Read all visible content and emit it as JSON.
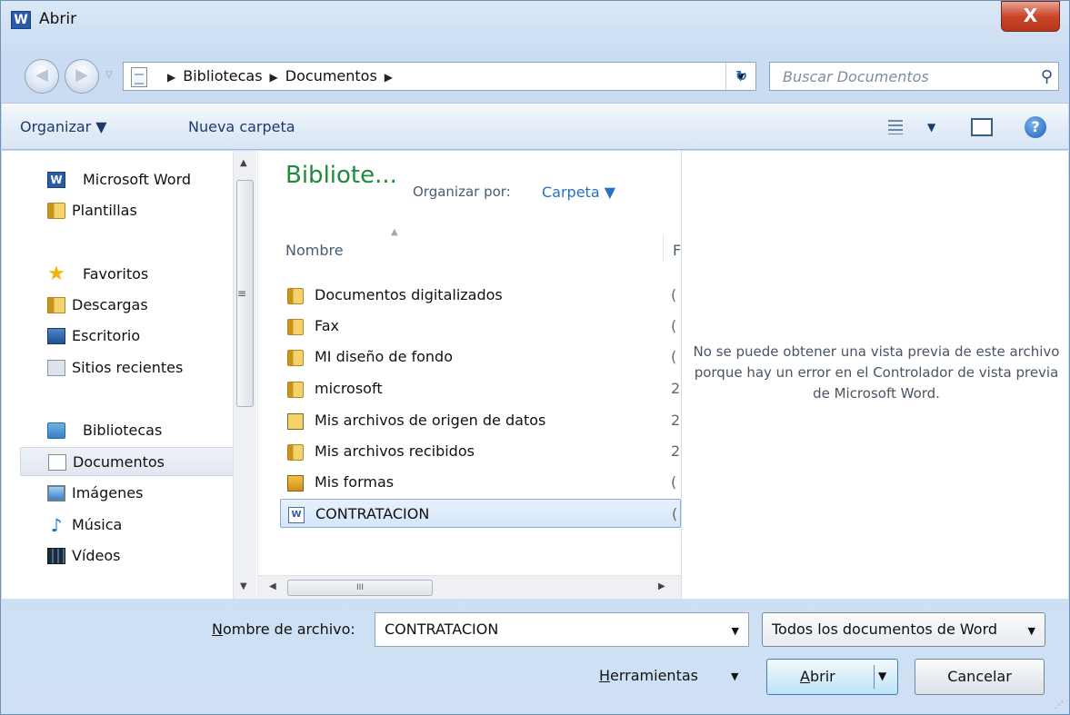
{
  "window": {
    "title": "Abrir",
    "close_label": "X"
  },
  "address_bar": {
    "crumbs": [
      "Bibliotecas",
      "Documentos"
    ],
    "search_placeholder": "Buscar Documentos"
  },
  "toolbar": {
    "organize": "Organizar ▼",
    "new_folder": "Nueva carpeta",
    "help": "?"
  },
  "nav_pane": {
    "groups": [
      {
        "label": "Microsoft Word",
        "items": [
          {
            "label": "Plantillas"
          }
        ]
      },
      {
        "label": "Favoritos",
        "items": [
          {
            "label": "Descargas"
          },
          {
            "label": "Escritorio"
          },
          {
            "label": "Sitios recientes"
          }
        ]
      },
      {
        "label": "Bibliotecas",
        "items": [
          {
            "label": "Documentos"
          },
          {
            "label": "Imágenes"
          },
          {
            "label": "Música"
          },
          {
            "label": "Vídeos"
          }
        ]
      }
    ],
    "selected": "Documentos"
  },
  "file_pane": {
    "library_title": "Bibliote...",
    "arrange_label": "Organizar por:",
    "arrange_value": "Carpeta ▼",
    "column_name": "Nombre",
    "column_next": "F",
    "files": [
      {
        "name": "Documentos digitalizados",
        "trail": "("
      },
      {
        "name": "Fax",
        "trail": "("
      },
      {
        "name": "MI diseño de fondo",
        "trail": "("
      },
      {
        "name": "microsoft",
        "trail": "2"
      },
      {
        "name": "Mis archivos de origen de datos",
        "trail": "2"
      },
      {
        "name": "Mis archivos recibidos",
        "trail": "2"
      },
      {
        "name": "Mis formas",
        "trail": "("
      },
      {
        "name": "CONTRATACION",
        "trail": "("
      }
    ],
    "selected": "CONTRATACION",
    "hscroll_grip": "III"
  },
  "preview": {
    "message": "No se puede obtener una vista previa de este archivo porque hay un error en el Controlador de vista previa de Microsoft Word."
  },
  "footer": {
    "filename_label_u": "N",
    "filename_label_rest": "ombre de archivo:",
    "filename_value": "CONTRATACION",
    "filter_value": "Todos los documentos de Word",
    "tools_u": "H",
    "tools_rest": "erramientas",
    "open_u": "A",
    "open_rest": "brir",
    "cancel": "Cancelar"
  }
}
